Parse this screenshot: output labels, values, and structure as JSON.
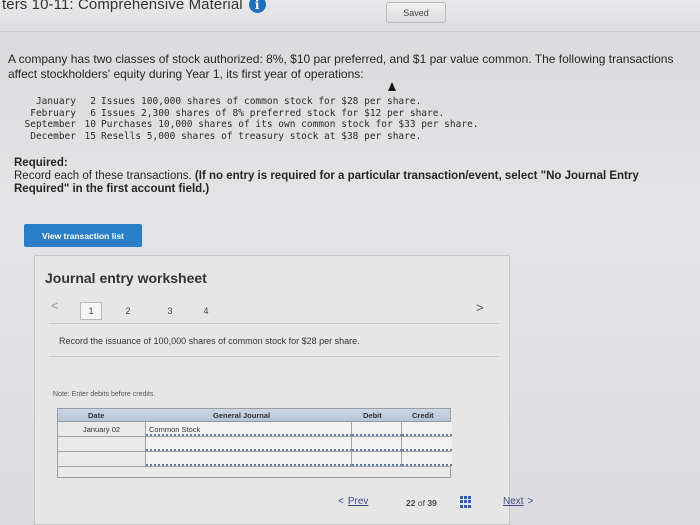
{
  "header": {
    "title": "ters 10-11: Comprehensive Material",
    "info_icon": "i",
    "saved_label": "Saved"
  },
  "problem": {
    "text": "A company has two classes of stock authorized: 8%, $10 par preferred, and $1 par value common. The following transactions affect stockholders' equity during Year 1, its first year of operations:"
  },
  "transactions": [
    {
      "month": "January",
      "day": "2",
      "text": "Issues 100,000 shares of common stock for $28 per share."
    },
    {
      "month": "February",
      "day": "6",
      "text": "Issues 2,300 shares of 8% preferred stock for $12 per share."
    },
    {
      "month": "September",
      "day": "10",
      "text": "Purchases 10,000 shares of its own common stock for $33 per share."
    },
    {
      "month": "December",
      "day": "15",
      "text": "Resells 5,000 shares of treasury stock at $38 per share."
    }
  ],
  "required": {
    "heading": "Required:",
    "text": "Record each of these transactions.",
    "note": "(If no entry is required for a particular transaction/event, select \"No Journal Entry Required\" in the first account field.)"
  },
  "buttons": {
    "view_transaction_list": "View transaction list"
  },
  "worksheet": {
    "title": "Journal entry worksheet",
    "prev_arrow": "<",
    "next_arrow": ">",
    "pages": [
      "1",
      "2",
      "3",
      "4"
    ],
    "active_page": "1",
    "task": "Record the issuance of 100,000 shares of common stock for $28 per share.",
    "note": "Note: Enter debits before credits.",
    "columns": {
      "date": "Date",
      "journal": "General Journal",
      "debit": "Debit",
      "credit": "Credit"
    },
    "rows": [
      {
        "date": "January 02",
        "account": "Common Stock",
        "debit": "",
        "credit": ""
      },
      {
        "date": "",
        "account": "",
        "debit": "",
        "credit": ""
      },
      {
        "date": "",
        "account": "",
        "debit": "",
        "credit": ""
      }
    ]
  },
  "footer": {
    "prev_label": "Prev",
    "prev_chevron": "<",
    "current_page": "22",
    "of_label": "of",
    "total_pages": "39",
    "next_label": "Next",
    "next_chevron": ">"
  }
}
